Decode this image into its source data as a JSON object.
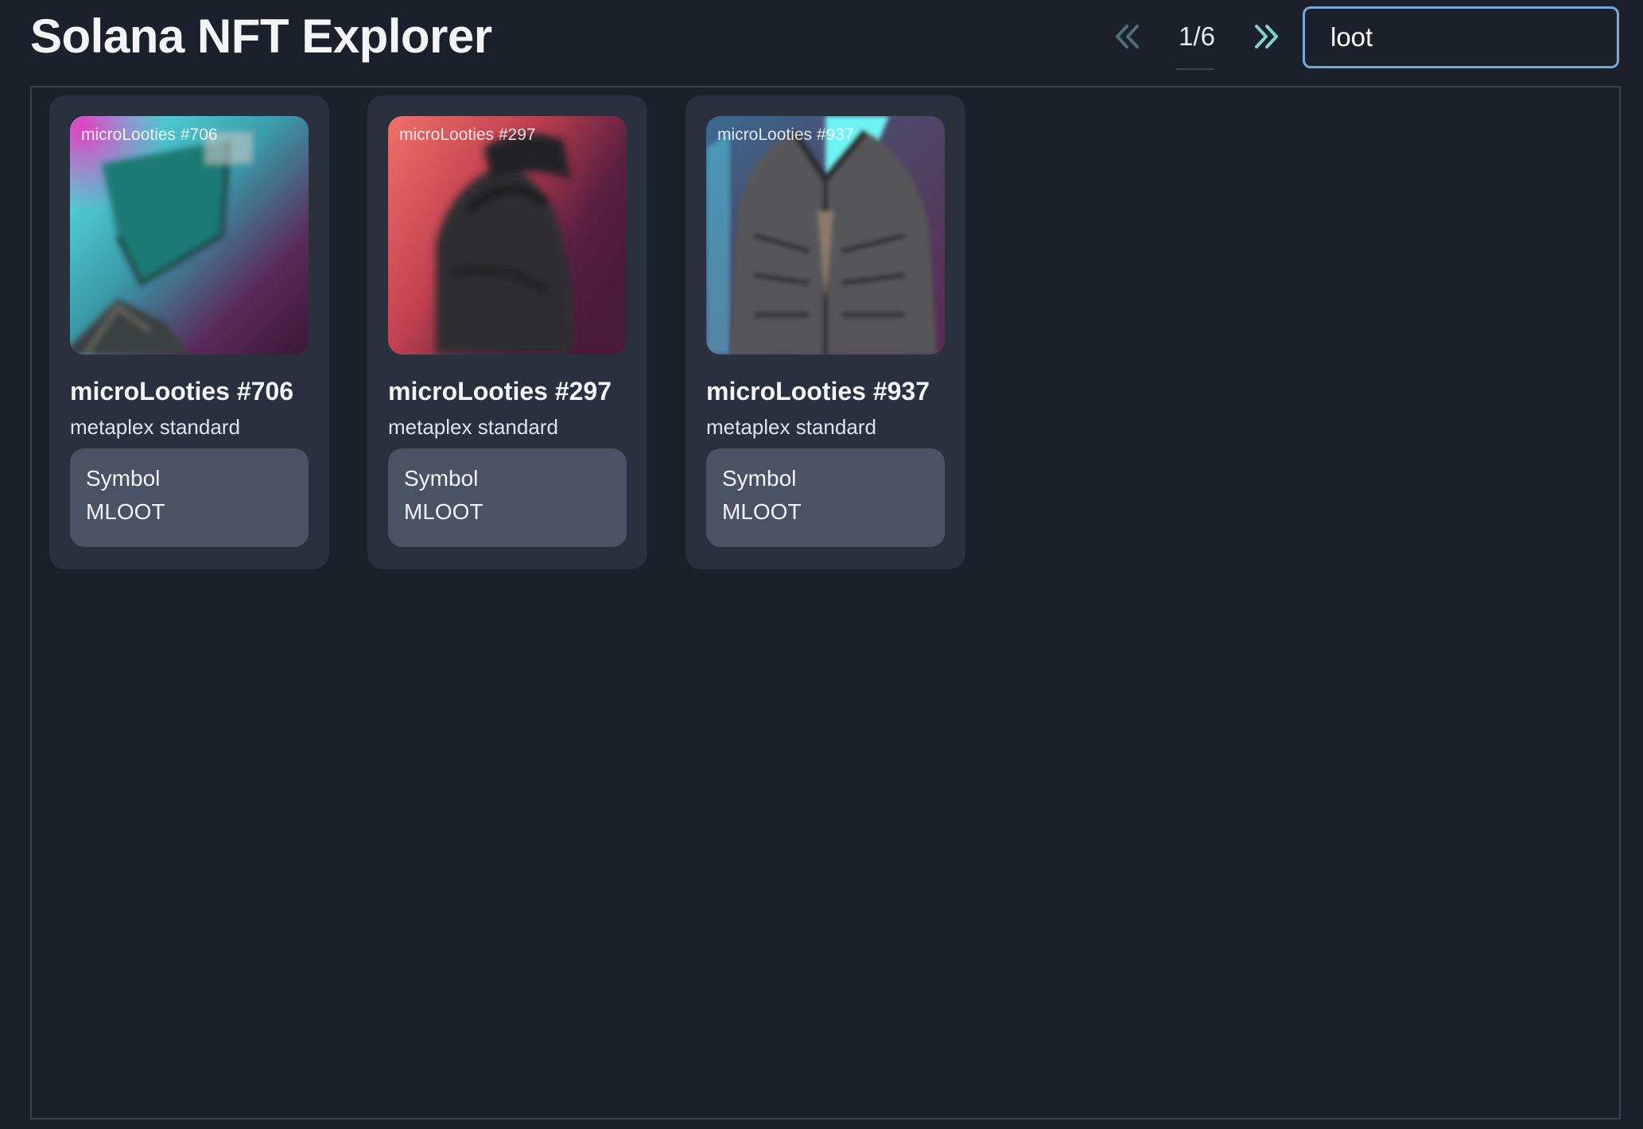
{
  "app": {
    "title": "Solana NFT Explorer"
  },
  "pager": {
    "prev_icon": "double-chevron-left-icon",
    "next_icon": "double-chevron-right-icon",
    "page_text": "1/6",
    "current_page": 1,
    "total_pages": 6
  },
  "search": {
    "value": "loot",
    "placeholder": ""
  },
  "colors": {
    "background": "#1c202b",
    "card": "#2a303e",
    "symbol_box": "#4a5263",
    "search_border": "#78a7da",
    "next_arrow": "#7fd3c7",
    "prev_arrow": "#4d6f73"
  },
  "nfts": [
    {
      "image_caption": "microLooties #706",
      "name": "microLooties #706",
      "standard": "metaplex standard",
      "symbol_label": "Symbol",
      "symbol_value": "MLOOT"
    },
    {
      "image_caption": "microLooties #297",
      "name": "microLooties #297",
      "standard": "metaplex standard",
      "symbol_label": "Symbol",
      "symbol_value": "MLOOT"
    },
    {
      "image_caption": "microLooties #937",
      "name": "microLooties #937",
      "standard": "metaplex standard",
      "symbol_label": "Symbol",
      "symbol_value": "MLOOT"
    }
  ]
}
